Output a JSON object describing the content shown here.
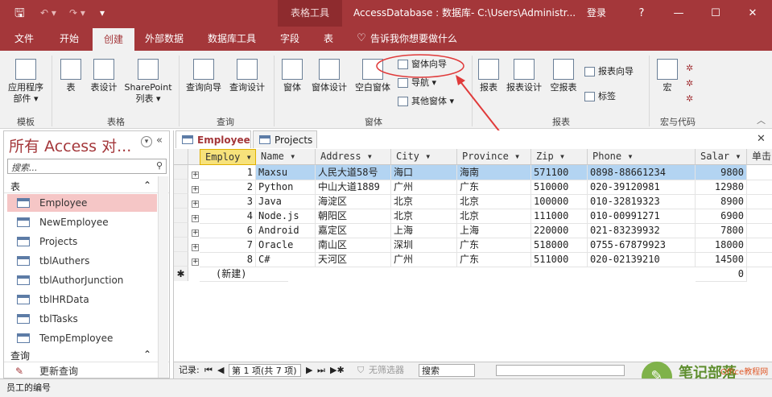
{
  "titlebar": {
    "context_tab": "表格工具",
    "title": "AccessDatabase : 数据库- C:\\Users\\Administr...",
    "login": "登录",
    "help": "?",
    "minimize": "—",
    "restore": "☐",
    "close": "✕"
  },
  "tabs": [
    "文件",
    "开始",
    "创建",
    "外部数据",
    "数据库工具",
    "字段",
    "表",
    "告诉我你想要做什么"
  ],
  "ribbon": {
    "template": {
      "app_parts": "应用程序\n部件 ▾",
      "label": "模板"
    },
    "tables": {
      "table": "表",
      "design": "表设计",
      "sharepoint": "SharePoint\n列表 ▾",
      "label": "表格"
    },
    "queries": {
      "wizard": "查询向导",
      "design": "查询设计",
      "label": "查询"
    },
    "forms": {
      "form": "窗体",
      "design": "窗体设计",
      "blank": "空白窗体",
      "wizard": "窗体向导",
      "navigation": "导航 ▾",
      "more": "其他窗体 ▾",
      "label": "窗体"
    },
    "reports": {
      "report": "报表",
      "design": "报表设计",
      "blank": "空报表",
      "wizard": "报表向导",
      "labels": "标签",
      "label": "报表"
    },
    "macros": {
      "macro": "宏",
      "label": "宏与代码"
    }
  },
  "nav": {
    "title": "所有 Access 对...",
    "search_placeholder": "搜索...",
    "section_tables": "表",
    "tables": [
      "Employee",
      "NewEmployee",
      "Projects",
      "tblAuthers",
      "tblAuthorJunction",
      "tblHRData",
      "tblTasks",
      "TempEmployee"
    ],
    "section_queries": "查询",
    "queries": [
      "更新查询"
    ]
  },
  "doc_tabs": [
    "Employee",
    "Projects"
  ],
  "grid": {
    "columns": [
      "Employ ▾",
      "Name ▾",
      "Address ▾",
      "City ▾",
      "Province ▾",
      "Zip ▾",
      "Phone ▾",
      "Salar ▾",
      "单击"
    ],
    "rows": [
      [
        "1",
        "Maxsu",
        "人民大道58号",
        "海口",
        "海南",
        "571100",
        "0898-88661234",
        "9800"
      ],
      [
        "2",
        "Python",
        "中山大道1889",
        "广州",
        "广东",
        "510000",
        "020-39120981",
        "12980"
      ],
      [
        "3",
        "Java",
        "海淀区",
        "北京",
        "北京",
        "100000",
        "010-32819323",
        "8900"
      ],
      [
        "4",
        "Node.js",
        "朝阳区",
        "北京",
        "北京",
        "111000",
        "010-00991271",
        "6900"
      ],
      [
        "6",
        "Android",
        "嘉定区",
        "上海",
        "上海",
        "220000",
        "021-83239932",
        "7800"
      ],
      [
        "7",
        "Oracle",
        "南山区",
        "深圳",
        "广东",
        "518000",
        "0755-67879923",
        "18000"
      ],
      [
        "8",
        "C#",
        "天河区",
        "广州",
        "广东",
        "511000",
        "020-02139210",
        "14500"
      ]
    ],
    "new_row_label": "(新建)",
    "new_row_salary": "0"
  },
  "record_nav": {
    "label": "记录:",
    "position": "第 1 项(共 7 项)",
    "filter": "无筛选器",
    "search": "搜索"
  },
  "status": "员工的编号",
  "watermark": {
    "text": "笔记部落",
    "sub": "Office教程网"
  },
  "accent": "#a4373a"
}
